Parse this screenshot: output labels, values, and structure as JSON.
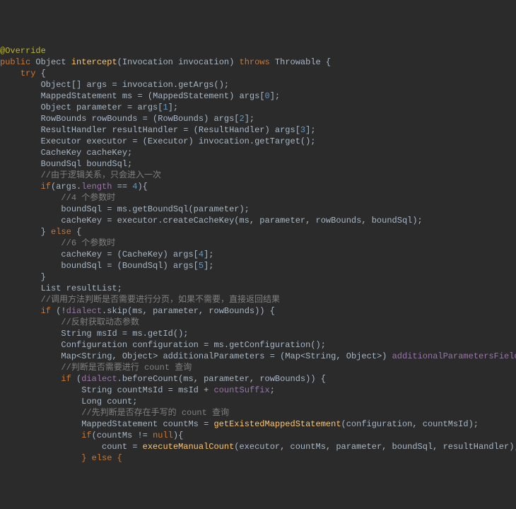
{
  "c": {
    "anno": "@Override",
    "kw": {
      "public": "public",
      "try": "try",
      "if": "if",
      "else": "else",
      "throws": "throws",
      "null": "null"
    },
    "t": {
      "Object": "Object",
      "Invocation": "Invocation",
      "Throwable": "Throwable",
      "MappedStatement": "MappedStatement",
      "RowBounds": "RowBounds",
      "ResultHandler": "ResultHandler",
      "Executor": "Executor",
      "CacheKey": "CacheKey",
      "BoundSql": "BoundSql",
      "List": "List",
      "String": "String",
      "Configuration": "Configuration",
      "Map": "Map",
      "Long": "Long"
    },
    "id": {
      "intercept": "intercept",
      "invocation": "invocation",
      "args": "args",
      "ms": "ms",
      "parameter": "parameter",
      "rowBounds": "rowBounds",
      "resultHandler": "resultHandler",
      "executor": "executor",
      "cacheKey": "cacheKey",
      "boundSql": "boundSql",
      "length": "length",
      "resultList": "resultList",
      "dialect": "dialect",
      "msId": "msId",
      "configuration": "configuration",
      "additionalParameters": "additionalParameters",
      "additionalParametersField": "additionalParametersField",
      "countMsId": "countMsId",
      "countSuffix": "countSuffix",
      "count": "count",
      "countMs": "countMs"
    },
    "m": {
      "getArgs": "getArgs",
      "getBoundSql": "getBoundSql",
      "createCacheKey": "createCacheKey",
      "getTarget": "getTarget",
      "skip": "skip",
      "getId": "getId",
      "getConfiguration": "getConfiguration",
      "beforeCount": "beforeCount",
      "getExistedMappedStatement": "getExistedMappedStatement",
      "executeManualCount": "executeManualCount"
    },
    "num": {
      "n0": "0",
      "n1": "1",
      "n2": "2",
      "n3": "3",
      "n4": "4",
      "n5": "5"
    },
    "cmt": {
      "c1": "//由于逻辑关系，只会进入一次",
      "c2": "//4 个参数时",
      "c3": "//6 个参数时",
      "c4": "//调用方法判断是否需要进行分页，如果不需要，直接返回结果",
      "c5": "//反射获取动态参数",
      "c6": "//判断是否需要进行 count 查询",
      "c7": "//先判断是否存在手写的 count 查询"
    },
    "tail_else": "} else {"
  }
}
